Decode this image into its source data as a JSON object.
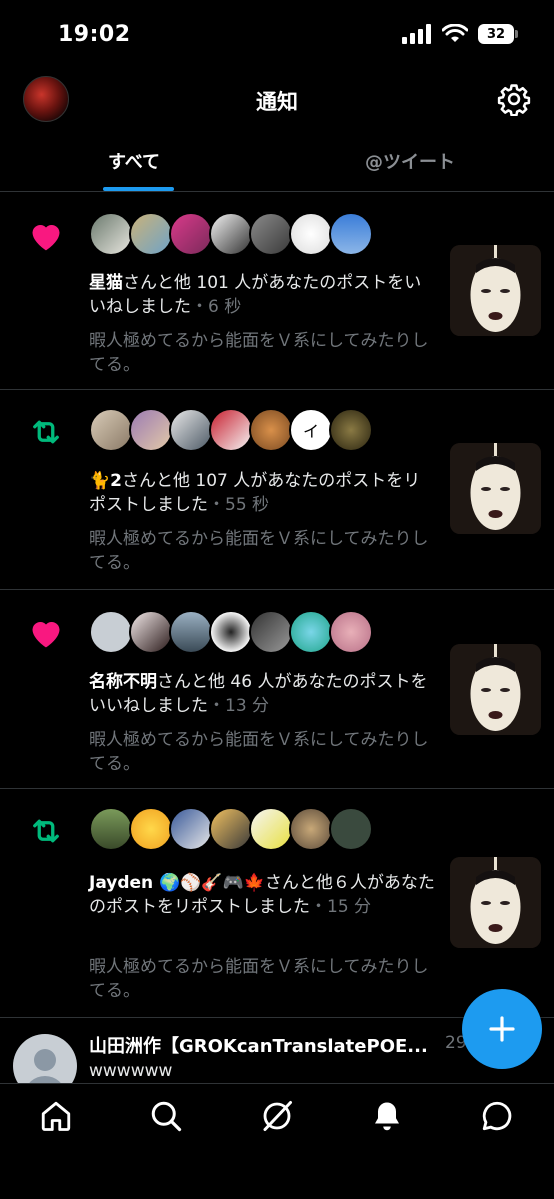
{
  "status": {
    "time": "19:02",
    "battery": "32"
  },
  "header": {
    "title": "通知"
  },
  "tabs": [
    {
      "label": "すべて",
      "active": true
    },
    {
      "label": "@ツイート",
      "active": false
    }
  ],
  "notifications": [
    {
      "type": "like",
      "icon": "heart-icon",
      "actor": "星猫",
      "text": "さんと他 101 人があなたのポストをいいねしました",
      "time": "・6 秒",
      "preview": "暇人極めてるから能面をＶ系にしてみたりしてる。"
    },
    {
      "type": "repost",
      "icon": "repost-icon",
      "actor": "🐈2",
      "text": "さんと他 107 人があなたのポストをリポストしました",
      "time": "・55 秒",
      "preview": "暇人極めてるから能面をＶ系にしてみたりしてる。"
    },
    {
      "type": "like",
      "icon": "heart-icon",
      "actor": "名称不明",
      "text": "さんと他 46 人があなたのポストをいいねしました",
      "time": "・13 分",
      "preview": "暇人極めてるから能面をＶ系にしてみたりしてる。"
    },
    {
      "type": "repost",
      "icon": "repost-icon",
      "actor": "Jayden 🌍⚾🎸🎮🍁",
      "text": "さんと他６人があなたのポストをリポストしました",
      "time": "・15 分",
      "preview": "暇人極めてるから能面をＶ系にしてみたりしてる。"
    }
  ],
  "partial": {
    "name": "山田洲作【GROKcanTranslatePOE...",
    "meta": "29",
    "body": "wwwwww"
  },
  "colors": {
    "accent": "#1d9bf0",
    "like": "#f91880",
    "repost": "#00ba7c",
    "muted": "#71767b"
  }
}
